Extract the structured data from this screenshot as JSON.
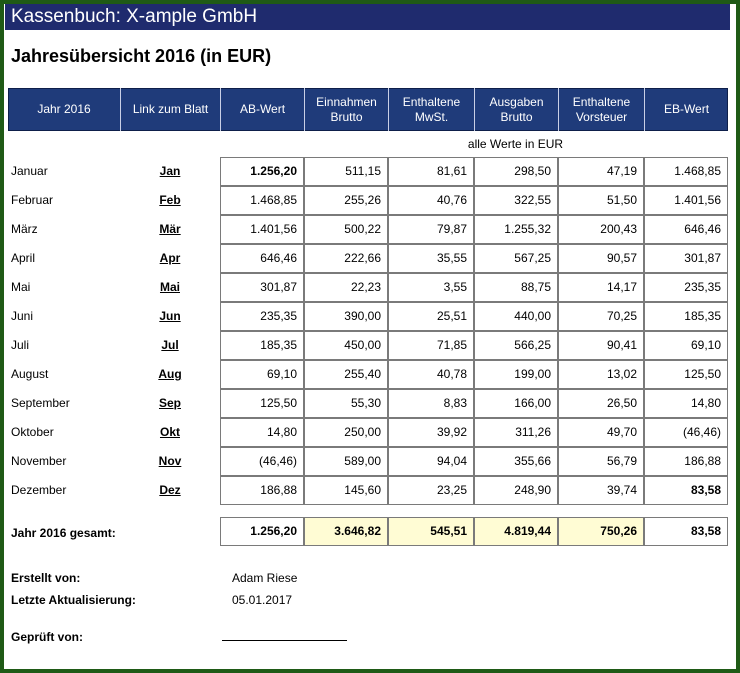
{
  "app_title": "Kassenbuch: X-ample GmbH",
  "page_title": "Jahresübersicht 2016 (in EUR)",
  "headers": [
    "Jahr 2016",
    "Link zum Blatt",
    "AB-Wert",
    "Einnahmen Brutto",
    "Enthaltene MwSt.",
    "Ausgaben Brutto",
    "Enthaltene Vorsteuer",
    "EB-Wert"
  ],
  "unit_note": "alle Werte in EUR",
  "rows": [
    {
      "month": "Januar",
      "link": "Jan",
      "ab": "1.256,20",
      "einnahmen": "511,15",
      "mwst": "81,61",
      "ausgaben": "298,50",
      "vorsteuer": "47,19",
      "eb": "1.468,85"
    },
    {
      "month": "Februar",
      "link": "Feb",
      "ab": "1.468,85",
      "einnahmen": "255,26",
      "mwst": "40,76",
      "ausgaben": "322,55",
      "vorsteuer": "51,50",
      "eb": "1.401,56"
    },
    {
      "month": "März",
      "link": "Mär",
      "ab": "1.401,56",
      "einnahmen": "500,22",
      "mwst": "79,87",
      "ausgaben": "1.255,32",
      "vorsteuer": "200,43",
      "eb": "646,46"
    },
    {
      "month": "April",
      "link": "Apr",
      "ab": "646,46",
      "einnahmen": "222,66",
      "mwst": "35,55",
      "ausgaben": "567,25",
      "vorsteuer": "90,57",
      "eb": "301,87"
    },
    {
      "month": "Mai",
      "link": "Mai",
      "ab": "301,87",
      "einnahmen": "22,23",
      "mwst": "3,55",
      "ausgaben": "88,75",
      "vorsteuer": "14,17",
      "eb": "235,35"
    },
    {
      "month": "Juni",
      "link": "Jun",
      "ab": "235,35",
      "einnahmen": "390,00",
      "mwst": "25,51",
      "ausgaben": "440,00",
      "vorsteuer": "70,25",
      "eb": "185,35"
    },
    {
      "month": "Juli",
      "link": "Jul",
      "ab": "185,35",
      "einnahmen": "450,00",
      "mwst": "71,85",
      "ausgaben": "566,25",
      "vorsteuer": "90,41",
      "eb": "69,10"
    },
    {
      "month": "August",
      "link": "Aug",
      "ab": "69,10",
      "einnahmen": "255,40",
      "mwst": "40,78",
      "ausgaben": "199,00",
      "vorsteuer": "13,02",
      "eb": "125,50"
    },
    {
      "month": "September",
      "link": "Sep",
      "ab": "125,50",
      "einnahmen": "55,30",
      "mwst": "8,83",
      "ausgaben": "166,00",
      "vorsteuer": "26,50",
      "eb": "14,80"
    },
    {
      "month": "Oktober",
      "link": "Okt",
      "ab": "14,80",
      "einnahmen": "250,00",
      "mwst": "39,92",
      "ausgaben": "311,26",
      "vorsteuer": "49,70",
      "eb": "(46,46)"
    },
    {
      "month": "November",
      "link": "Nov",
      "ab": "(46,46)",
      "einnahmen": "589,00",
      "mwst": "94,04",
      "ausgaben": "355,66",
      "vorsteuer": "56,79",
      "eb": "186,88"
    },
    {
      "month": "Dezember",
      "link": "Dez",
      "ab": "186,88",
      "einnahmen": "145,60",
      "mwst": "23,25",
      "ausgaben": "248,90",
      "vorsteuer": "39,74",
      "eb": "83,58"
    }
  ],
  "total": {
    "label": "Jahr 2016 gesamt:",
    "ab": "1.256,20",
    "einnahmen": "3.646,82",
    "mwst": "545,51",
    "ausgaben": "4.819,44",
    "vorsteuer": "750,26",
    "eb": "83,58"
  },
  "footer": {
    "created_label": "Erstellt von:",
    "created_value": "Adam Riese",
    "updated_label": "Letzte Aktualisierung:",
    "updated_value": "05.01.2017",
    "checked_label": "Geprüft von:"
  },
  "colors": {
    "title_bar": "#1f2b6e",
    "header_bg": "#1f3b7a",
    "frame": "#1f5a16",
    "total_highlight": "#fffcd4"
  }
}
